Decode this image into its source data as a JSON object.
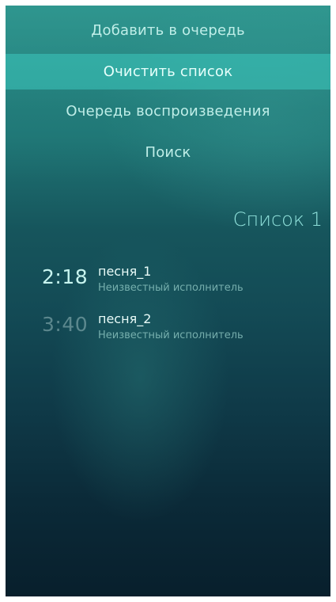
{
  "pulley_menu": {
    "items": [
      {
        "label": "Добавить в очередь"
      },
      {
        "label": "Очистить список"
      },
      {
        "label": "Очередь воспроизведения"
      },
      {
        "label": "Поиск"
      }
    ]
  },
  "page": {
    "title": "Список 1"
  },
  "tracks": [
    {
      "duration": "2:18",
      "title": "песня_1",
      "artist": "Неизвестный исполнитель"
    },
    {
      "duration": "3:40",
      "title": "песня_2",
      "artist": "Неизвестный исполнитель"
    }
  ],
  "colors": {
    "accent": "#3cc8be",
    "highlight_text": "#e6fffb",
    "primary_text": "#bfeee8"
  }
}
